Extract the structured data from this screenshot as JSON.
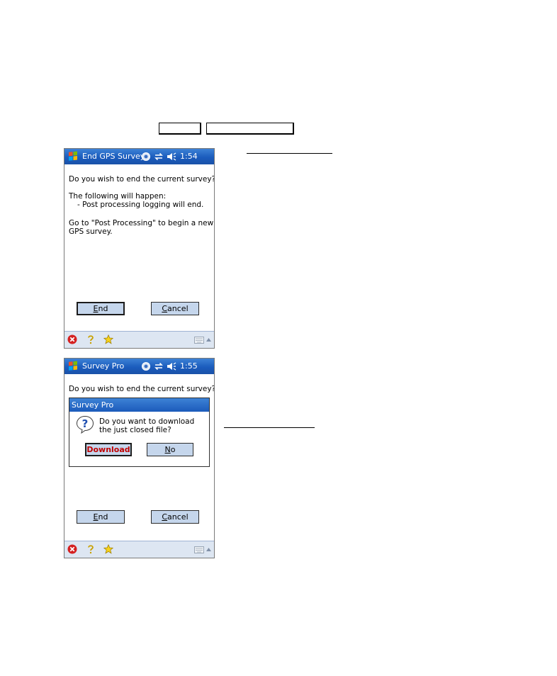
{
  "screen1": {
    "title": "End GPS Survey",
    "clock": "1:54",
    "lines": [
      "Do you wish to end the current survey?",
      "The following will happen:",
      "- Post processing logging will end.",
      "Go to \"Post Processing\" to begin a new",
      "GPS survey."
    ],
    "end_button_mnemonic": "E",
    "end_button_rest": "nd",
    "cancel_button_mnemonic": "C",
    "cancel_button_rest": "ancel"
  },
  "screen2": {
    "title": "Survey Pro",
    "clock": "1:55",
    "line": "Do you wish to end the current survey?",
    "dialog_title": "Survey Pro",
    "dialog_message_1": "Do you want to download",
    "dialog_message_2": "the just closed file?",
    "download_label": "Download",
    "no_button_mnemonic": "N",
    "no_button_rest": "o",
    "end_button_mnemonic": "E",
    "end_button_rest": "nd",
    "cancel_button_mnemonic": "C",
    "cancel_button_rest": "ancel"
  },
  "icons": {
    "start": "windows-flag-icon",
    "connectivity": "connectivity-icon",
    "sync": "sync-arrows-icon",
    "volume": "speaker-icon",
    "close": "close-icon",
    "help": "help-icon",
    "favorite": "star-icon",
    "keyboard": "keyboard-icon",
    "question": "question-icon"
  },
  "colors": {
    "titlebar": "#1b5cbd",
    "button_face": "#c5d6ec",
    "download_text": "#c00000",
    "bottom_bar": "#dde6f2"
  }
}
